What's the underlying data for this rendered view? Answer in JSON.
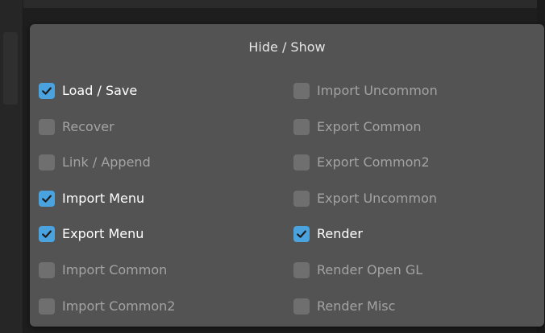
{
  "popup": {
    "title": "Hide / Show",
    "accent_color": "#4aa3df",
    "left_column": [
      {
        "label": "Load / Save",
        "checked": true
      },
      {
        "label": "Recover",
        "checked": false
      },
      {
        "label": "Link / Append",
        "checked": false
      },
      {
        "label": "Import Menu",
        "checked": true
      },
      {
        "label": "Export Menu",
        "checked": true
      },
      {
        "label": "Import Common",
        "checked": false
      },
      {
        "label": "Import Common2",
        "checked": false
      }
    ],
    "right_column": [
      {
        "label": "Import Uncommon",
        "checked": false
      },
      {
        "label": "Export Common",
        "checked": false
      },
      {
        "label": "Export Common2",
        "checked": false
      },
      {
        "label": "Export Uncommon",
        "checked": false
      },
      {
        "label": "Render",
        "checked": true
      },
      {
        "label": "Render Open GL",
        "checked": false
      },
      {
        "label": "Render Misc",
        "checked": false
      }
    ]
  }
}
